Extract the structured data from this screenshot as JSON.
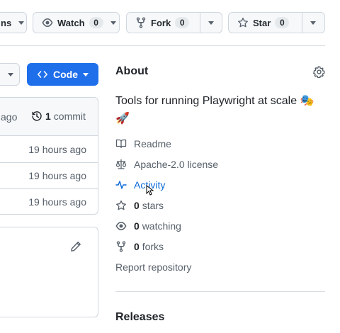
{
  "header": {
    "left_partial": "ns",
    "watch": {
      "label": "Watch",
      "count": "0"
    },
    "fork": {
      "label": "Fork",
      "count": "0"
    },
    "star": {
      "label": "Star",
      "count": "0"
    }
  },
  "toolbar": {
    "code_label": "Code"
  },
  "file_list": {
    "last_commit_time": "ago",
    "commit_count": "1",
    "commit_label": "commit",
    "rows": [
      {
        "time": "19 hours ago"
      },
      {
        "time": "19 hours ago"
      },
      {
        "time": "19 hours ago"
      }
    ]
  },
  "about": {
    "title": "About",
    "description": "Tools for running Playwright at scale 🎭 🚀",
    "items": {
      "readme": "Readme",
      "license": "Apache-2.0 license",
      "activity": "Activity",
      "stars_count": "0",
      "stars_label": "stars",
      "watching_count": "0",
      "watching_label": "watching",
      "forks_count": "0",
      "forks_label": "forks"
    },
    "report": "Report repository"
  },
  "releases": {
    "title": "Releases"
  },
  "colors": {
    "accent": "#1f6feb",
    "link": "#0969da",
    "muted": "#57606a",
    "border": "#d0d7de"
  }
}
